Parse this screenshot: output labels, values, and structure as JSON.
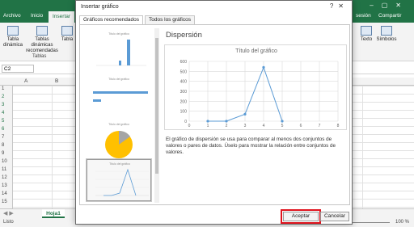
{
  "excel": {
    "tabs": [
      "Archivo",
      "Inicio",
      "Insertar"
    ],
    "right_tabs": [
      "sesión",
      "Compartir"
    ],
    "ribbon_buttons": [
      "Tabla dinámica",
      "Tablas dinámicas recomendadas",
      "Tabla"
    ],
    "ribbon_right_buttons": [
      "Texto",
      "Símbolos"
    ],
    "group_label": "Tablas",
    "name_box": "C2",
    "columns": [
      "A",
      "B"
    ],
    "rows": [
      "1",
      "2",
      "3",
      "4",
      "5",
      "6",
      "7",
      "8",
      "9",
      "10",
      "11",
      "12",
      "13",
      "14",
      "15"
    ],
    "sheet_tab": "Hoja1",
    "status": "Listo",
    "zoom": "100 %"
  },
  "dialog": {
    "title": "Insertar gráfico",
    "tabs": [
      "Gráficos recomendados",
      "Todos los gráficos"
    ],
    "thumb_title": "Título del gráfico",
    "preview_heading": "Dispersión",
    "description": "El gráfico de dispersión se usa para comparar al menos dos conjuntos de valores o pares de datos. Úselo para mostrar la relación entre conjuntos de valores.",
    "ok_label": "Aceptar",
    "cancel_label": "Cancelar"
  },
  "chart_data": {
    "type": "scatter",
    "title": "Título del gráfico",
    "x": [
      1,
      2,
      3,
      4,
      5
    ],
    "y": [
      0,
      0,
      70,
      540,
      0
    ],
    "xlim": [
      0,
      8
    ],
    "ylim": [
      0,
      600
    ],
    "xticks": [
      0,
      1,
      2,
      3,
      4,
      5,
      6,
      7,
      8
    ],
    "yticks": [
      0,
      100,
      200,
      300,
      400,
      500,
      600
    ],
    "grid": true,
    "color": "#5b9bd5"
  }
}
